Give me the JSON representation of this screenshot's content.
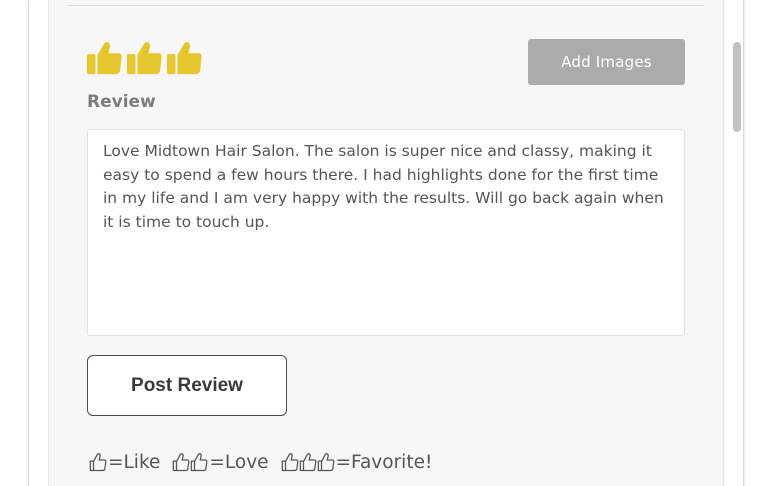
{
  "rating": {
    "selected_count": 3,
    "max": 3,
    "color": "#e6c62f"
  },
  "actions": {
    "add_images_label": "Add Images",
    "post_review_label": "Post Review"
  },
  "review": {
    "label": "Review",
    "text": "Love Midtown Hair Salon. The salon is super nice and classy, making it easy to spend a few hours there. I had highlights done for the first time in my life and I am very happy with the results. Will go back again when it is time to touch up."
  },
  "legend": {
    "like": "=Like",
    "love": "=Love",
    "favorite": "=Favorite!"
  }
}
